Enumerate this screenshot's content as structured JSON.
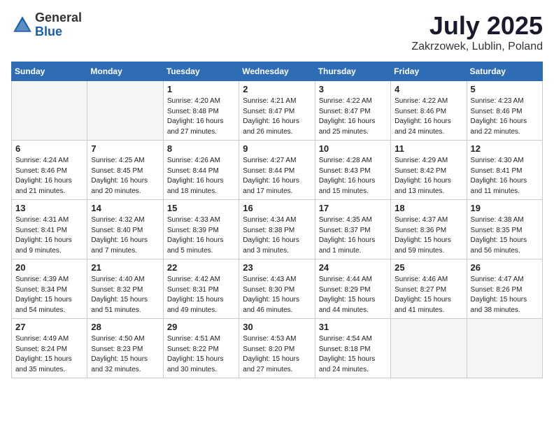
{
  "header": {
    "logo_line1": "General",
    "logo_line2": "Blue",
    "title": "July 2025",
    "location": "Zakrzowek, Lublin, Poland"
  },
  "weekdays": [
    "Sunday",
    "Monday",
    "Tuesday",
    "Wednesday",
    "Thursday",
    "Friday",
    "Saturday"
  ],
  "weeks": [
    [
      {
        "day": "",
        "info": ""
      },
      {
        "day": "",
        "info": ""
      },
      {
        "day": "1",
        "info": "Sunrise: 4:20 AM\nSunset: 8:48 PM\nDaylight: 16 hours\nand 27 minutes."
      },
      {
        "day": "2",
        "info": "Sunrise: 4:21 AM\nSunset: 8:47 PM\nDaylight: 16 hours\nand 26 minutes."
      },
      {
        "day": "3",
        "info": "Sunrise: 4:22 AM\nSunset: 8:47 PM\nDaylight: 16 hours\nand 25 minutes."
      },
      {
        "day": "4",
        "info": "Sunrise: 4:22 AM\nSunset: 8:46 PM\nDaylight: 16 hours\nand 24 minutes."
      },
      {
        "day": "5",
        "info": "Sunrise: 4:23 AM\nSunset: 8:46 PM\nDaylight: 16 hours\nand 22 minutes."
      }
    ],
    [
      {
        "day": "6",
        "info": "Sunrise: 4:24 AM\nSunset: 8:46 PM\nDaylight: 16 hours\nand 21 minutes."
      },
      {
        "day": "7",
        "info": "Sunrise: 4:25 AM\nSunset: 8:45 PM\nDaylight: 16 hours\nand 20 minutes."
      },
      {
        "day": "8",
        "info": "Sunrise: 4:26 AM\nSunset: 8:44 PM\nDaylight: 16 hours\nand 18 minutes."
      },
      {
        "day": "9",
        "info": "Sunrise: 4:27 AM\nSunset: 8:44 PM\nDaylight: 16 hours\nand 17 minutes."
      },
      {
        "day": "10",
        "info": "Sunrise: 4:28 AM\nSunset: 8:43 PM\nDaylight: 16 hours\nand 15 minutes."
      },
      {
        "day": "11",
        "info": "Sunrise: 4:29 AM\nSunset: 8:42 PM\nDaylight: 16 hours\nand 13 minutes."
      },
      {
        "day": "12",
        "info": "Sunrise: 4:30 AM\nSunset: 8:41 PM\nDaylight: 16 hours\nand 11 minutes."
      }
    ],
    [
      {
        "day": "13",
        "info": "Sunrise: 4:31 AM\nSunset: 8:41 PM\nDaylight: 16 hours\nand 9 minutes."
      },
      {
        "day": "14",
        "info": "Sunrise: 4:32 AM\nSunset: 8:40 PM\nDaylight: 16 hours\nand 7 minutes."
      },
      {
        "day": "15",
        "info": "Sunrise: 4:33 AM\nSunset: 8:39 PM\nDaylight: 16 hours\nand 5 minutes."
      },
      {
        "day": "16",
        "info": "Sunrise: 4:34 AM\nSunset: 8:38 PM\nDaylight: 16 hours\nand 3 minutes."
      },
      {
        "day": "17",
        "info": "Sunrise: 4:35 AM\nSunset: 8:37 PM\nDaylight: 16 hours\nand 1 minute."
      },
      {
        "day": "18",
        "info": "Sunrise: 4:37 AM\nSunset: 8:36 PM\nDaylight: 15 hours\nand 59 minutes."
      },
      {
        "day": "19",
        "info": "Sunrise: 4:38 AM\nSunset: 8:35 PM\nDaylight: 15 hours\nand 56 minutes."
      }
    ],
    [
      {
        "day": "20",
        "info": "Sunrise: 4:39 AM\nSunset: 8:34 PM\nDaylight: 15 hours\nand 54 minutes."
      },
      {
        "day": "21",
        "info": "Sunrise: 4:40 AM\nSunset: 8:32 PM\nDaylight: 15 hours\nand 51 minutes."
      },
      {
        "day": "22",
        "info": "Sunrise: 4:42 AM\nSunset: 8:31 PM\nDaylight: 15 hours\nand 49 minutes."
      },
      {
        "day": "23",
        "info": "Sunrise: 4:43 AM\nSunset: 8:30 PM\nDaylight: 15 hours\nand 46 minutes."
      },
      {
        "day": "24",
        "info": "Sunrise: 4:44 AM\nSunset: 8:29 PM\nDaylight: 15 hours\nand 44 minutes."
      },
      {
        "day": "25",
        "info": "Sunrise: 4:46 AM\nSunset: 8:27 PM\nDaylight: 15 hours\nand 41 minutes."
      },
      {
        "day": "26",
        "info": "Sunrise: 4:47 AM\nSunset: 8:26 PM\nDaylight: 15 hours\nand 38 minutes."
      }
    ],
    [
      {
        "day": "27",
        "info": "Sunrise: 4:49 AM\nSunset: 8:24 PM\nDaylight: 15 hours\nand 35 minutes."
      },
      {
        "day": "28",
        "info": "Sunrise: 4:50 AM\nSunset: 8:23 PM\nDaylight: 15 hours\nand 32 minutes."
      },
      {
        "day": "29",
        "info": "Sunrise: 4:51 AM\nSunset: 8:22 PM\nDaylight: 15 hours\nand 30 minutes."
      },
      {
        "day": "30",
        "info": "Sunrise: 4:53 AM\nSunset: 8:20 PM\nDaylight: 15 hours\nand 27 minutes."
      },
      {
        "day": "31",
        "info": "Sunrise: 4:54 AM\nSunset: 8:18 PM\nDaylight: 15 hours\nand 24 minutes."
      },
      {
        "day": "",
        "info": ""
      },
      {
        "day": "",
        "info": ""
      }
    ]
  ]
}
